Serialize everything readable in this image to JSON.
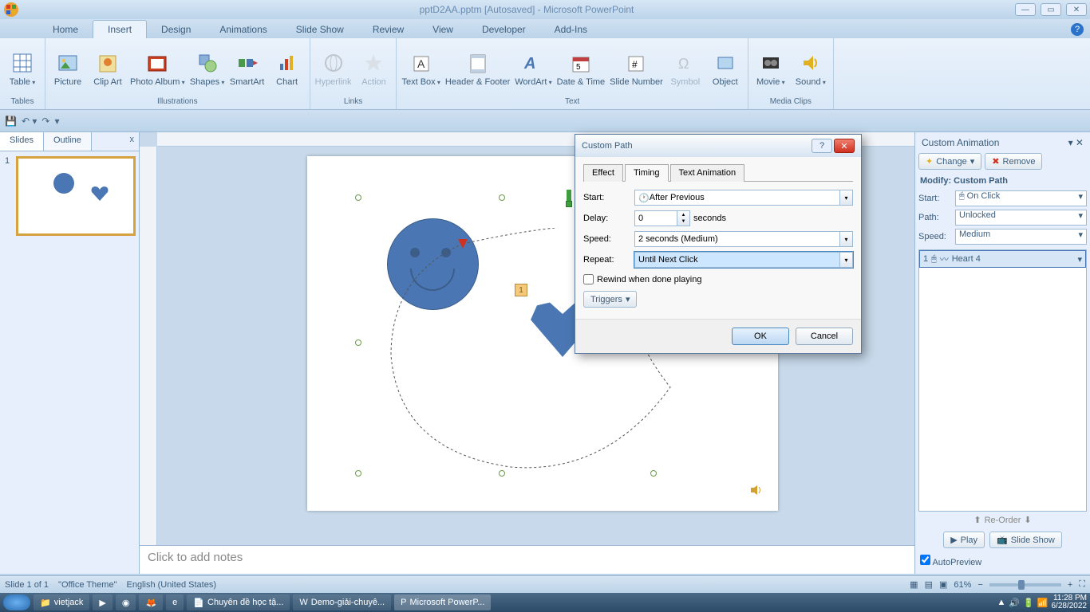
{
  "title": "pptD2AA.pptm [Autosaved] - Microsoft PowerPoint",
  "tabs": [
    "Home",
    "Insert",
    "Design",
    "Animations",
    "Slide Show",
    "Review",
    "View",
    "Developer",
    "Add-Ins"
  ],
  "active_tab": "Insert",
  "ribbon_groups": {
    "tables": {
      "label": "Tables",
      "items": [
        "Table"
      ]
    },
    "illustrations": {
      "label": "Illustrations",
      "items": [
        "Picture",
        "Clip Art",
        "Photo Album",
        "Shapes",
        "SmartArt",
        "Chart"
      ]
    },
    "links": {
      "label": "Links",
      "items": [
        "Hyperlink",
        "Action"
      ]
    },
    "text": {
      "label": "Text",
      "items": [
        "Text Box",
        "Header & Footer",
        "WordArt",
        "Date & Time",
        "Slide Number",
        "Symbol",
        "Object"
      ]
    },
    "media": {
      "label": "Media Clips",
      "items": [
        "Movie",
        "Sound"
      ]
    }
  },
  "slides_panel": {
    "tab1": "Slides",
    "tab2": "Outline",
    "close": "x"
  },
  "notes_placeholder": "Click to add notes",
  "dialog": {
    "title": "Custom Path",
    "tabs": [
      "Effect",
      "Timing",
      "Text Animation"
    ],
    "active_tab": "Timing",
    "start_label": "Start:",
    "start_value": "After Previous",
    "delay_label": "Delay:",
    "delay_value": "0",
    "delay_unit": "seconds",
    "speed_label": "Speed:",
    "speed_value": "2 seconds (Medium)",
    "repeat_label": "Repeat:",
    "repeat_value": "Until Next Click",
    "rewind": "Rewind when done playing",
    "triggers": "Triggers",
    "ok": "OK",
    "cancel": "Cancel"
  },
  "anim_pane": {
    "title": "Custom Animation",
    "change": "Change",
    "remove": "Remove",
    "modify": "Modify: Custom Path",
    "start_label": "Start:",
    "start_value": "On Click",
    "path_label": "Path:",
    "path_value": "Unlocked",
    "speed_label": "Speed:",
    "speed_value": "Medium",
    "item_num": "1",
    "item_name": "Heart 4",
    "reorder": "Re-Order",
    "play": "Play",
    "slideshow": "Slide Show",
    "autopreview": "AutoPreview"
  },
  "badge": "1",
  "statusbar": {
    "slide": "Slide 1 of 1",
    "theme": "\"Office Theme\"",
    "lang": "English (United States)",
    "zoom": "61%"
  },
  "taskbar": {
    "folder": "vietjack",
    "app1": "Chuyên đề học tậ...",
    "app2": "Demo-giải-chuyê...",
    "app3": "Microsoft PowerP...",
    "time": "11:28 PM",
    "date": "6/28/2022"
  }
}
